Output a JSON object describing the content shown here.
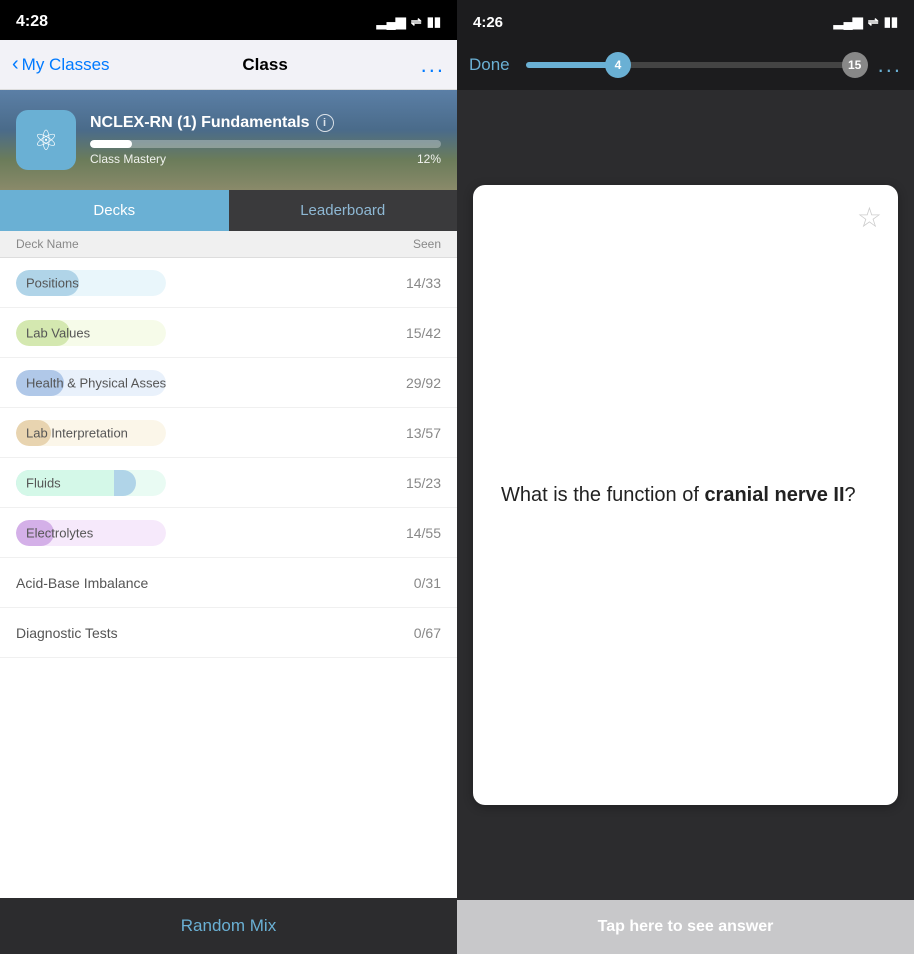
{
  "left": {
    "status": {
      "time": "4:28",
      "signal": "▂▄▆",
      "wifi": "WiFi",
      "battery": "Battery"
    },
    "nav": {
      "back_label": "My Classes",
      "title": "Class",
      "more": "..."
    },
    "class": {
      "name": "NCLEX-RN (1) Fundamentals",
      "mastery_label": "Class Mastery",
      "mastery_percent": "12%",
      "mastery_value": 12
    },
    "tabs": {
      "decks": "Decks",
      "leaderboard": "Leaderboard"
    },
    "table_headers": {
      "deck_name": "Deck Name",
      "seen": "Seen"
    },
    "decks": [
      {
        "name": "Positions",
        "seen": "14/33",
        "pill_color": "#b0d4e8",
        "pill_bg": "#d4eef8",
        "fill_pct": 42,
        "has_pill": true
      },
      {
        "name": "Lab Values",
        "seen": "15/42",
        "pill_color": "#d4e8b0",
        "pill_bg": "#eef8d4",
        "fill_pct": 36,
        "has_pill": true
      },
      {
        "name": "Health & Physical Assessment",
        "seen": "29/92",
        "pill_color": "#b0c8e8",
        "pill_bg": "#d4e4f8",
        "fill_pct": 32,
        "has_pill": false
      },
      {
        "name": "Lab Interpretation",
        "seen": "13/57",
        "pill_color": "#e8d4b0",
        "pill_bg": "#f8eed4",
        "fill_pct": 23,
        "has_pill": false
      },
      {
        "name": "Fluids",
        "seen": "15/23",
        "pill_color": "#b0e8c8",
        "pill_bg": "#d4f8e8",
        "fill_pct": 65,
        "has_pill": true,
        "second_fill": "#b0d4e8",
        "second_pct": 80
      },
      {
        "name": "Electrolytes",
        "seen": "14/55",
        "pill_color": "#d4b0e8",
        "pill_bg": "#eed4f8",
        "fill_pct": 25,
        "has_pill": true
      },
      {
        "name": "Acid-Base Imbalance",
        "seen": "0/31",
        "has_pill": false
      },
      {
        "name": "Diagnostic Tests",
        "seen": "0/67",
        "has_pill": false
      }
    ],
    "random_mix": "Random Mix"
  },
  "right": {
    "status": {
      "time": "4:26",
      "signal": "▂▄▆",
      "wifi": "WiFi",
      "battery": "Battery"
    },
    "nav": {
      "done": "Done",
      "current": "4",
      "total": "15",
      "more": "...",
      "progress_pct": 27
    },
    "card": {
      "question_prefix": "What is the function of ",
      "question_bold": "cranial nerve II",
      "question_suffix": "?",
      "star": "★"
    },
    "tap_label": "Tap here to see answer"
  }
}
